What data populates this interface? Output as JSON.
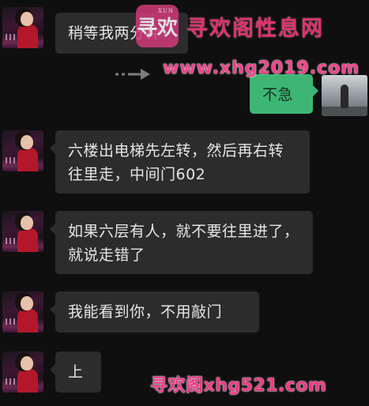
{
  "messages": [
    {
      "side": "left",
      "text": "稍等我两分钟"
    },
    {
      "side": "right",
      "text": "不急"
    },
    {
      "side": "left",
      "text": "六楼出电梯先左转，然后再右转往里走，中间门602"
    },
    {
      "side": "left",
      "text": "如果六层有人，就不要往里进了，就说走错了"
    },
    {
      "side": "left",
      "text": "我能看到你，不用敲门"
    },
    {
      "side": "left",
      "text": "上"
    }
  ],
  "watermark": {
    "logo_char": "寻欢",
    "logo_small": "XUN",
    "title": "寻欢阁性息网",
    "url_top": "www.xhg2019.com",
    "url_bottom": "寻欢阁xhg521.com"
  },
  "colors": {
    "background": "#0f0f0f",
    "bubble_left": "#2c2c2c",
    "bubble_right": "#3eb575",
    "watermark": "#e0336f"
  },
  "icons": [
    "avatar-contact",
    "avatar-self",
    "arrow-right-icon",
    "site-logo"
  ]
}
